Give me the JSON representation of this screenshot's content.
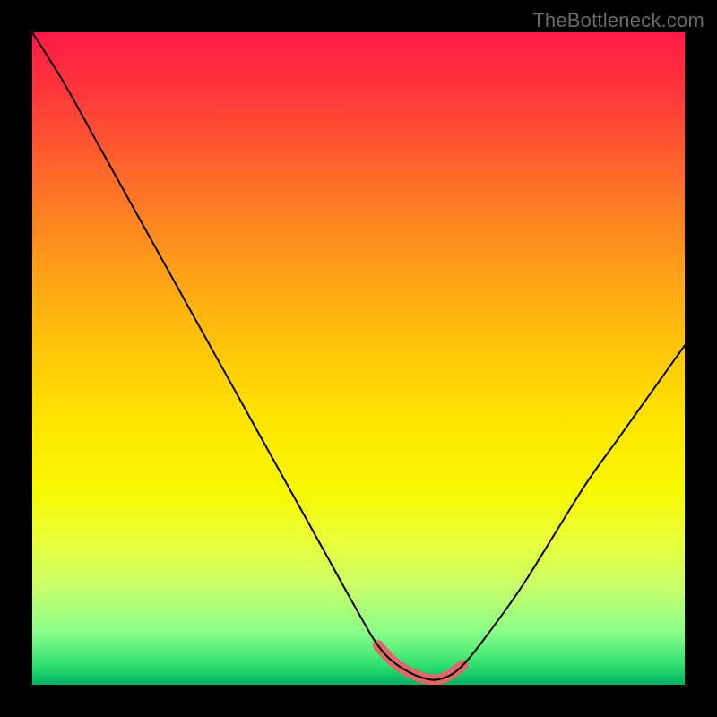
{
  "watermark": "TheBottleneck.com",
  "chart_data": {
    "type": "line",
    "title": "",
    "xlabel": "",
    "ylabel": "",
    "xlim": [
      0,
      100
    ],
    "ylim": [
      0,
      100
    ],
    "grid": false,
    "legend": false,
    "background_gradient": {
      "top": "#ff1a46",
      "mid": "#ffe600",
      "bottom": "#00b060"
    },
    "series": [
      {
        "name": "curve",
        "x": [
          0,
          5,
          10,
          15,
          20,
          25,
          30,
          35,
          40,
          45,
          50,
          53,
          56,
          60,
          63,
          66,
          70,
          75,
          80,
          85,
          90,
          95,
          100
        ],
        "values": [
          100,
          92,
          83,
          74,
          65,
          56,
          47,
          38,
          29,
          20,
          11,
          6,
          3,
          1,
          1,
          3,
          8,
          15,
          23,
          31,
          38,
          45,
          52
        ]
      }
    ],
    "highlight_range": {
      "x_start": 52,
      "x_end": 67,
      "note": "valley floor, thick salmon overlay"
    }
  }
}
